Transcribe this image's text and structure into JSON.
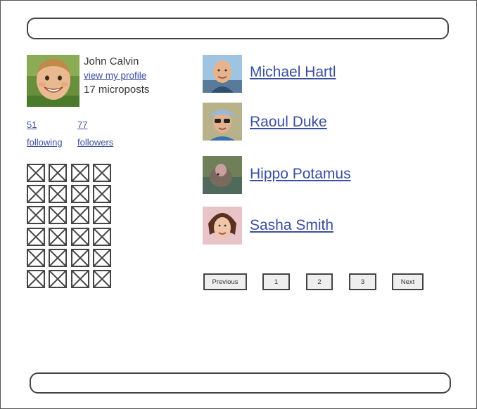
{
  "profile": {
    "name": "John Calvin",
    "profile_link": "view my profile",
    "microposts": "17 microposts"
  },
  "stats": {
    "following_count": "51",
    "following_label": "following",
    "followers_count": "77",
    "followers_label": "followers"
  },
  "users": [
    {
      "name": "Michael Hartl"
    },
    {
      "name": "Raoul Duke"
    },
    {
      "name": "Hippo Potamus"
    },
    {
      "name": "Sasha Smith"
    }
  ],
  "pagination": {
    "previous": "Previous",
    "pages": [
      "1",
      "2",
      "3"
    ],
    "next": "Next"
  },
  "colors": {
    "link": "#3b4fa0",
    "border": "#444444",
    "button_bg": "#eeeeee"
  }
}
